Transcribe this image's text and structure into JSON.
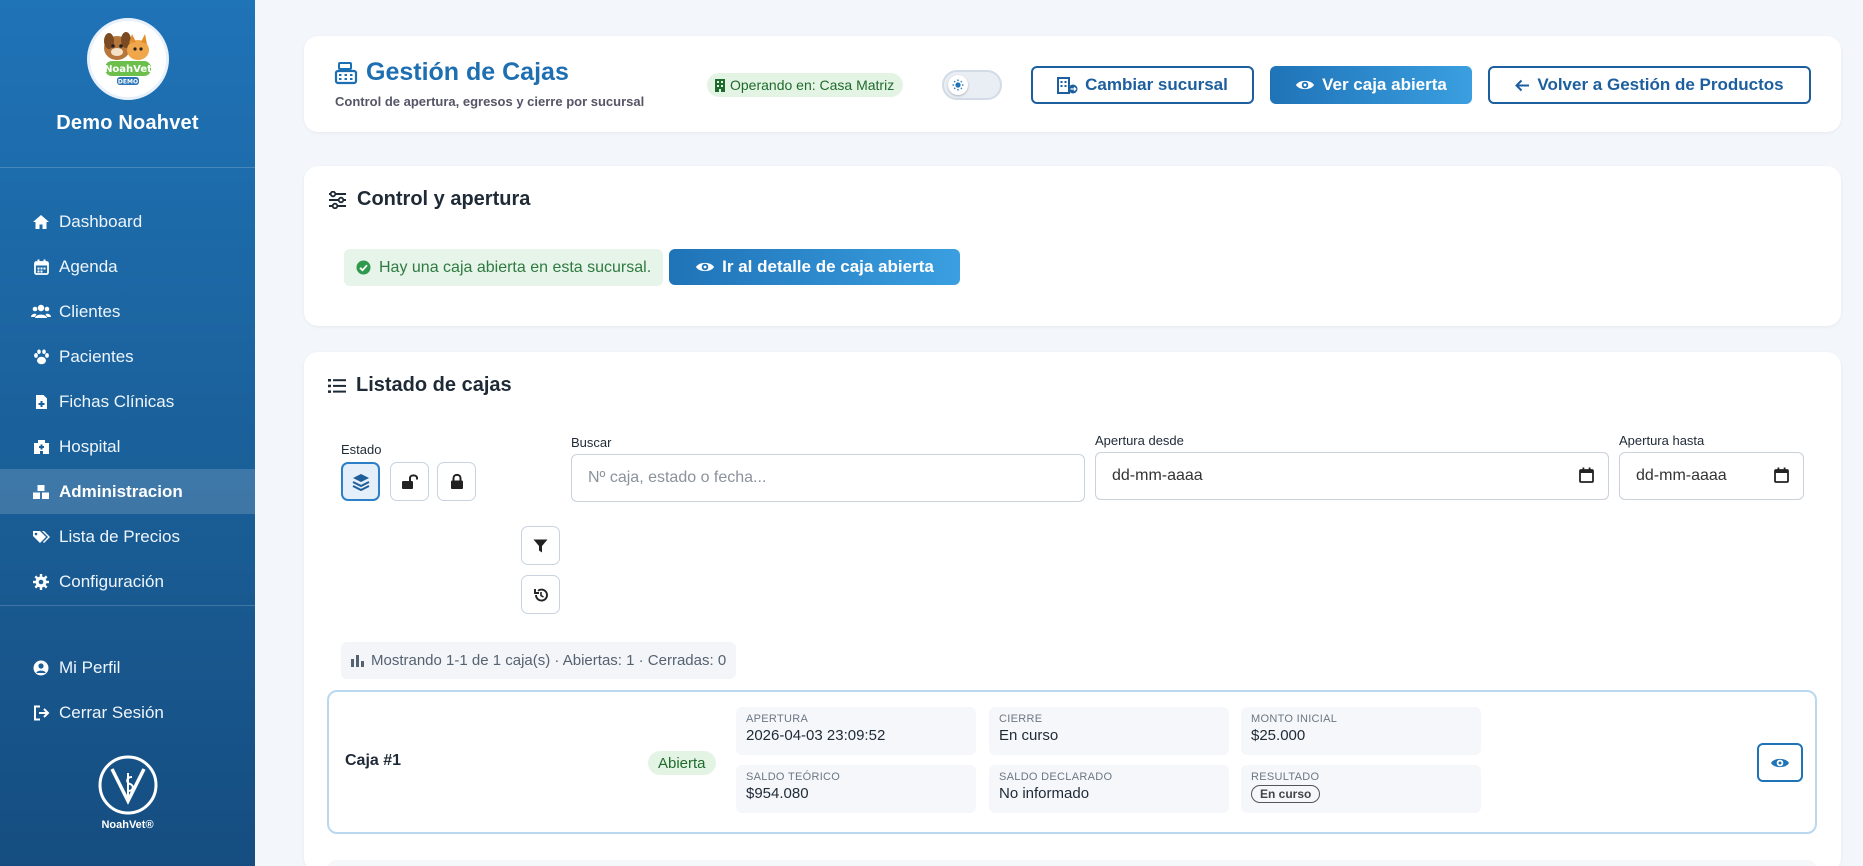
{
  "sidebar": {
    "brand_name": "Demo Noahvet",
    "logo_text": "NoahVet",
    "logo_sub": "DEMO",
    "items": [
      {
        "label": "Dashboard",
        "icon": "home-icon"
      },
      {
        "label": "Agenda",
        "icon": "calendar-icon"
      },
      {
        "label": "Clientes",
        "icon": "users-icon"
      },
      {
        "label": "Pacientes",
        "icon": "paw-icon"
      },
      {
        "label": "Fichas Clínicas",
        "icon": "file-medical-icon"
      },
      {
        "label": "Hospital",
        "icon": "hospital-icon"
      },
      {
        "label": "Administracion",
        "icon": "boxes-icon",
        "active": true
      },
      {
        "label": "Lista de Precios",
        "icon": "tags-icon"
      },
      {
        "label": "Configuración",
        "icon": "gear-icon"
      }
    ],
    "bottom_items": [
      {
        "label": "Mi Perfil",
        "icon": "user-circle-icon"
      },
      {
        "label": "Cerrar Sesión",
        "icon": "logout-icon"
      }
    ],
    "footer_text": "NoahVet®"
  },
  "header": {
    "title": "Gestión de Cajas",
    "subtitle": "Control de apertura, egresos y cierre por sucursal",
    "branch_badge": "Operando en: Casa Matriz",
    "change_branch": "Cambiar sucursal",
    "view_open": "Ver caja abierta",
    "back": "Volver a Gestión de Productos"
  },
  "control": {
    "title": "Control y apertura",
    "alert": "Hay una caja abierta en esta sucursal.",
    "detail_button": "Ir al detalle de caja abierta"
  },
  "listing": {
    "title": "Listado de cajas",
    "estado_label": "Estado",
    "search_label": "Buscar",
    "search_placeholder": "Nº caja, estado o fecha...",
    "from_label": "Apertura desde",
    "from_value": "dd-mm-aaaa",
    "to_label": "Apertura hasta",
    "to_value": "dd-mm-aaaa",
    "summary": "Mostrando 1-1 de 1 caja(s) · Abiertas: 1 · Cerradas: 0",
    "rows": [
      {
        "name": "Caja #1",
        "status": "Abierta",
        "apertura_label": "APERTURA",
        "apertura": "2026-04-03 23:09:52",
        "cierre_label": "CIERRE",
        "cierre": "En curso",
        "monto_label": "MONTO INICIAL",
        "monto": "$25.000",
        "teorico_label": "SALDO TEÓRICO",
        "teorico": "$954.080",
        "declarado_label": "SALDO DECLARADO",
        "declarado": "No informado",
        "resultado_label": "RESULTADO",
        "resultado": "En curso"
      }
    ]
  },
  "colors": {
    "primary": "#1f73b7",
    "sidebar": "#1a5f98",
    "success_bg": "#e3f4e4",
    "success_text": "#1f6b2c"
  }
}
